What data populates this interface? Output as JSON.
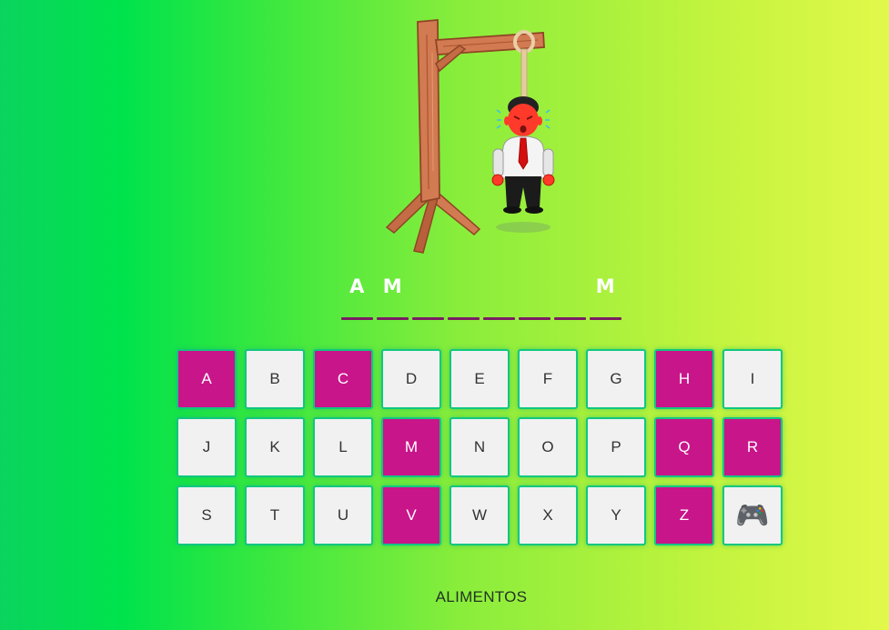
{
  "word": {
    "slots": [
      "A",
      "M",
      "",
      "",
      "",
      "",
      "",
      "M"
    ]
  },
  "keyboard": {
    "keys": [
      {
        "label": "A",
        "used": true
      },
      {
        "label": "B",
        "used": false
      },
      {
        "label": "C",
        "used": true
      },
      {
        "label": "D",
        "used": false
      },
      {
        "label": "E",
        "used": false
      },
      {
        "label": "F",
        "used": false
      },
      {
        "label": "G",
        "used": false
      },
      {
        "label": "H",
        "used": true
      },
      {
        "label": "I",
        "used": false
      },
      {
        "label": "J",
        "used": false
      },
      {
        "label": "K",
        "used": false
      },
      {
        "label": "L",
        "used": false
      },
      {
        "label": "M",
        "used": true
      },
      {
        "label": "N",
        "used": false
      },
      {
        "label": "O",
        "used": false
      },
      {
        "label": "P",
        "used": false
      },
      {
        "label": "Q",
        "used": true
      },
      {
        "label": "R",
        "used": true
      },
      {
        "label": "S",
        "used": false
      },
      {
        "label": "T",
        "used": false
      },
      {
        "label": "U",
        "used": false
      },
      {
        "label": "V",
        "used": true
      },
      {
        "label": "W",
        "used": false
      },
      {
        "label": "X",
        "used": false
      },
      {
        "label": "Y",
        "used": false
      },
      {
        "label": "Z",
        "used": true
      }
    ],
    "new_game_icon": "🎮"
  },
  "category": "ALIMENTOS",
  "colors": {
    "used_key": "#c8158a",
    "unused_key": "#f1f1f1",
    "key_border": "#10c77f",
    "slot_line": "#7a1e63"
  }
}
